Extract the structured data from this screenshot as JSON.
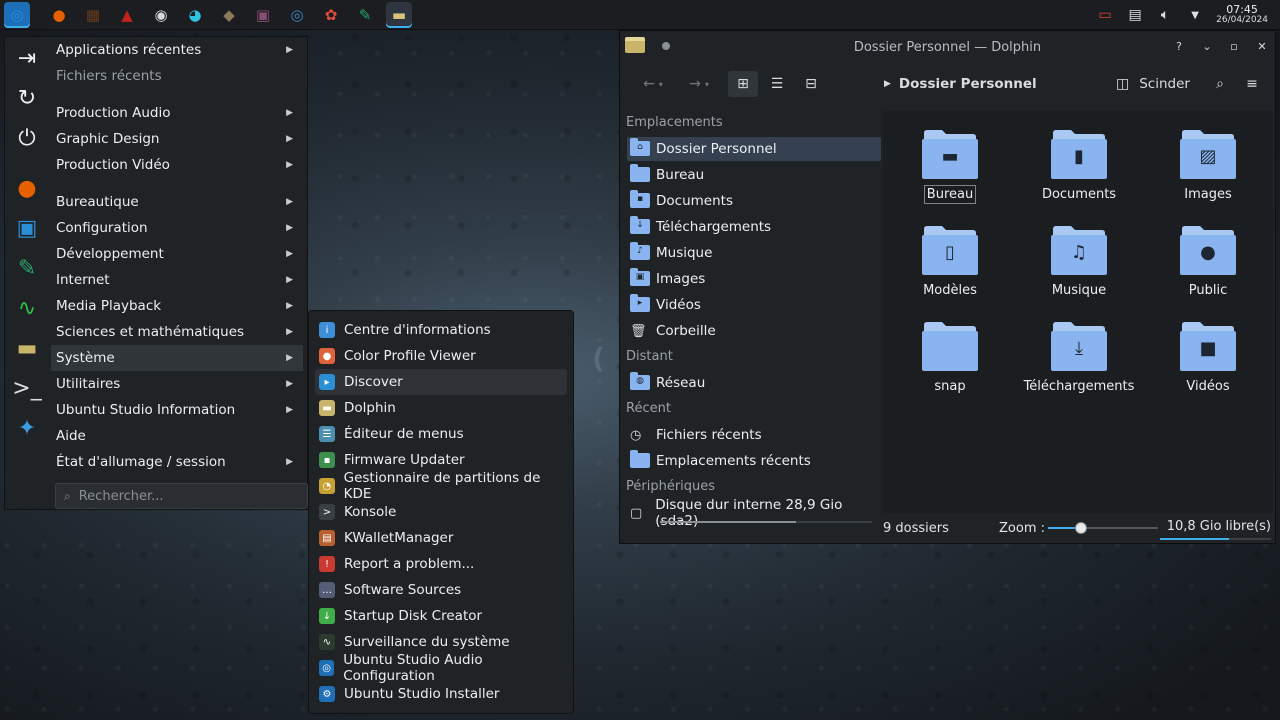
{
  "panel": {
    "tasks": [
      {
        "name": "ubuntu-studio-menu-icon",
        "glyph": "◎",
        "color": "#1f8fe0"
      },
      {
        "name": "firefox-icon",
        "glyph": "●",
        "color": "#e66000"
      },
      {
        "name": "ardour-icon",
        "glyph": "▦",
        "color": "#6b3a1e"
      },
      {
        "name": "triangle-app-icon",
        "glyph": "▲",
        "color": "#c0231f"
      },
      {
        "name": "obs-icon",
        "glyph": "◉",
        "color": "#d8d8d8"
      },
      {
        "name": "color-wheel-icon",
        "glyph": "◕",
        "color": "#2fc1e0"
      },
      {
        "name": "gimp-icon",
        "glyph": "◆",
        "color": "#8c7a5a"
      },
      {
        "name": "kdenlive-icon",
        "glyph": "▣",
        "color": "#8a4d72"
      },
      {
        "name": "record-icon",
        "glyph": "◎",
        "color": "#3d85c6"
      },
      {
        "name": "darktable-icon",
        "glyph": "✿",
        "color": "#e24d3a"
      },
      {
        "name": "krita-icon",
        "glyph": "✎",
        "color": "#2aa36d"
      },
      {
        "name": "dolphin-task-icon",
        "glyph": "▬",
        "color": "#d8c37a"
      }
    ],
    "clock_time": "07:45",
    "clock_date": "26/04/2024"
  },
  "menu": {
    "favorites": [
      {
        "name": "logout-icon",
        "glyph": "⇥"
      },
      {
        "name": "restart-icon",
        "glyph": "↻"
      },
      {
        "name": "power-icon",
        "glyph": "⏻"
      },
      {
        "name": "firefox-fav-icon",
        "glyph": "●"
      },
      {
        "name": "discover-fav-icon",
        "glyph": "▣"
      },
      {
        "name": "krita-fav-icon",
        "glyph": "✎"
      },
      {
        "name": "system-monitor-fav-icon",
        "glyph": "∿"
      },
      {
        "name": "dolphin-fav-icon",
        "glyph": "▬"
      },
      {
        "name": "konsole-fav-icon",
        "glyph": ">_"
      },
      {
        "name": "kde-connect-fav-icon",
        "glyph": "✦"
      }
    ],
    "items": [
      {
        "label": "Applications récentes",
        "arrow": true
      },
      {
        "label": "Fichiers récents",
        "arrow": false,
        "dim": true
      },
      {
        "label": "Production Audio",
        "arrow": true
      },
      {
        "label": "Graphic Design",
        "arrow": true
      },
      {
        "label": "Production Vidéo",
        "arrow": true
      },
      {
        "label": "Bureautique",
        "arrow": true
      },
      {
        "label": "Configuration",
        "arrow": true
      },
      {
        "label": "Développement",
        "arrow": true
      },
      {
        "label": "Internet",
        "arrow": true
      },
      {
        "label": "Media Playback",
        "arrow": true
      },
      {
        "label": "Sciences et mathématiques",
        "arrow": true
      },
      {
        "label": "Système",
        "arrow": true,
        "selected": true
      },
      {
        "label": "Utilitaires",
        "arrow": true
      },
      {
        "label": "Ubuntu Studio Information",
        "arrow": true
      },
      {
        "label": "Aide",
        "arrow": false
      },
      {
        "label": "État d'allumage / session",
        "arrow": true
      }
    ],
    "search_placeholder": "Rechercher..."
  },
  "submenu": {
    "items": [
      {
        "label": "Centre d'informations",
        "icon": "info-icon",
        "color": "#3d8fd8",
        "glyph": "i"
      },
      {
        "label": "Color Profile Viewer",
        "icon": "color-profile-icon",
        "color": "#e0623a",
        "glyph": "●"
      },
      {
        "label": "Discover",
        "icon": "discover-icon",
        "color": "#2b8fd6",
        "glyph": "▸",
        "selected": true
      },
      {
        "label": "Dolphin",
        "icon": "dolphin-icon",
        "color": "#c9b56a",
        "glyph": "▬"
      },
      {
        "label": "Éditeur de menus",
        "icon": "menu-editor-icon",
        "color": "#4a8fb0",
        "glyph": "☰"
      },
      {
        "label": "Firmware Updater",
        "icon": "firmware-icon",
        "color": "#3c8f4c",
        "glyph": "▪"
      },
      {
        "label": "Gestionnaire de partitions de KDE",
        "icon": "partition-icon",
        "color": "#c7a033",
        "glyph": "◔"
      },
      {
        "label": "Konsole",
        "icon": "konsole-icon",
        "color": "#3a3f44",
        "glyph": ">"
      },
      {
        "label": "KWalletManager",
        "icon": "kwallet-icon",
        "color": "#b8602f",
        "glyph": "▤"
      },
      {
        "label": "Report a problem...",
        "icon": "report-icon",
        "color": "#c83a32",
        "glyph": "!"
      },
      {
        "label": "Software Sources",
        "icon": "software-sources-icon",
        "color": "#555c78",
        "glyph": "…"
      },
      {
        "label": "Startup Disk Creator",
        "icon": "startup-disk-icon",
        "color": "#3fae49",
        "glyph": "↓"
      },
      {
        "label": "Surveillance du système",
        "icon": "system-monitor-icon",
        "color": "#2c3a30",
        "glyph": "∿"
      },
      {
        "label": "Ubuntu Studio Audio Configuration",
        "icon": "studio-audio-icon",
        "color": "#1f6fb8",
        "glyph": "◎"
      },
      {
        "label": "Ubuntu Studio Installer",
        "icon": "studio-installer-icon",
        "color": "#1f6fb8",
        "glyph": "⚙"
      }
    ]
  },
  "dolphin": {
    "title": "Dossier Personnel — Dolphin",
    "breadcrumb": "Dossier Personnel",
    "split_label": "Scinder",
    "places_sections": [
      {
        "heading": "Emplacements",
        "items": [
          {
            "label": "Dossier Personnel",
            "selected": true,
            "glyph": "⌂"
          },
          {
            "label": "Bureau",
            "glyph": ""
          },
          {
            "label": "Documents",
            "glyph": "▪"
          },
          {
            "label": "Téléchargements",
            "glyph": "↓"
          },
          {
            "label": "Musique",
            "glyph": "♪"
          },
          {
            "label": "Images",
            "glyph": "▣"
          },
          {
            "label": "Vidéos",
            "glyph": "▸"
          },
          {
            "label": "Corbeille",
            "glyph": "🗑"
          }
        ]
      },
      {
        "heading": "Distant",
        "items": [
          {
            "label": "Réseau",
            "glyph": "◍"
          }
        ]
      },
      {
        "heading": "Récent",
        "items": [
          {
            "label": "Fichiers récents",
            "glyph": "◷"
          },
          {
            "label": "Emplacements récents",
            "glyph": ""
          }
        ]
      },
      {
        "heading": "Périphériques",
        "items": [
          {
            "label": "Disque dur interne 28,9 Gio (sda2)",
            "glyph": "▢"
          }
        ]
      }
    ],
    "folders": [
      {
        "label": "Bureau",
        "glyph": "▬",
        "focused": true
      },
      {
        "label": "Documents",
        "glyph": "▮"
      },
      {
        "label": "Images",
        "glyph": "▨"
      },
      {
        "label": "Modèles",
        "glyph": "▯"
      },
      {
        "label": "Musique",
        "glyph": "♫"
      },
      {
        "label": "Public",
        "glyph": "●"
      },
      {
        "label": "snap",
        "glyph": ""
      },
      {
        "label": "Téléchargements",
        "glyph": "⤓"
      },
      {
        "label": "Vidéos",
        "glyph": "■"
      }
    ],
    "status_count": "9 dossiers",
    "zoom_label": "Zoom :",
    "zoom_fraction": 0.3,
    "free_space": "10,8 Gio libre(s)",
    "disk_used_fraction": 0.64,
    "free_used_fraction": 0.62
  },
  "colors": {
    "accent": "#3daee9",
    "folder_blue": "#8ab4f0",
    "selection": "#354050"
  }
}
